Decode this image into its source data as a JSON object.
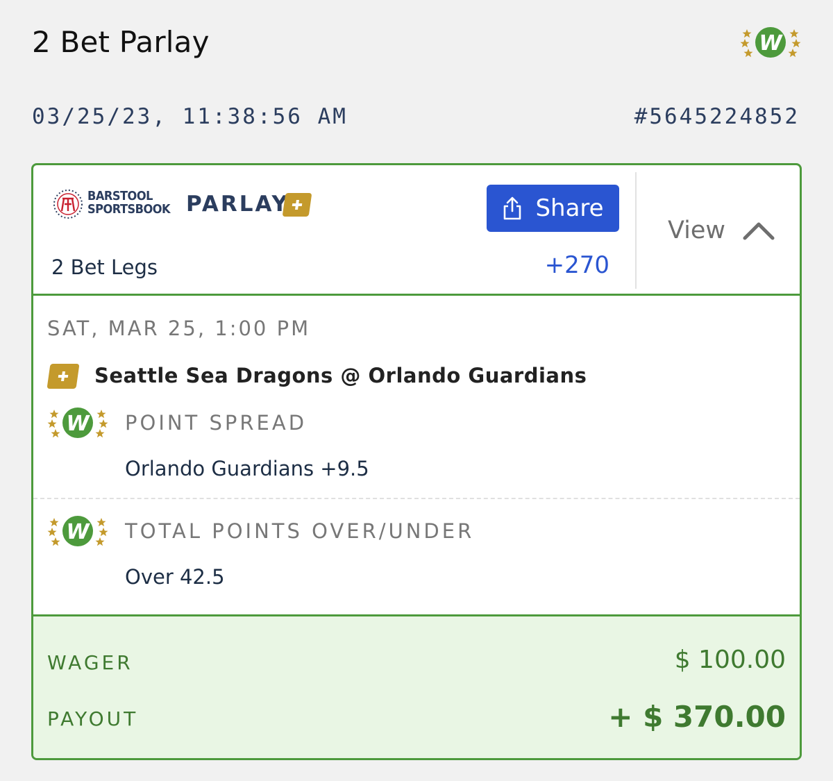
{
  "header": {
    "title": "2 Bet Parlay",
    "badge_icon": "win-stars-icon",
    "timestamp": "03/25/23, 11:38:56 AM",
    "bet_id": "#5645224852"
  },
  "card": {
    "logo_line1": "BARSTOOL",
    "logo_line2": "SPORTSBOOK",
    "bet_type": "PARLAY",
    "share_label": "Share",
    "legs_count": "2 Bet Legs",
    "odds": "+270",
    "view_label": "View",
    "game": {
      "date": "SAT, MAR 25, 1:00 PM",
      "matchup": "Seattle Sea Dragons @ Orlando Guardians"
    },
    "legs": [
      {
        "market": "POINT SPREAD",
        "selection": "Orlando Guardians +9.5",
        "result": "W"
      },
      {
        "market": "TOTAL POINTS OVER/UNDER",
        "selection": "Over 42.5",
        "result": "W"
      }
    ]
  },
  "footer": {
    "wager_label": "WAGER",
    "wager_value": "$ 100.00",
    "payout_label": "PAYOUT",
    "payout_value": "+ $ 370.00"
  },
  "colors": {
    "accent_blue": "#2a55d1",
    "win_green": "#4d9a3c",
    "star_gold": "#c49a2c",
    "footer_bg": "#e9f6e4"
  }
}
